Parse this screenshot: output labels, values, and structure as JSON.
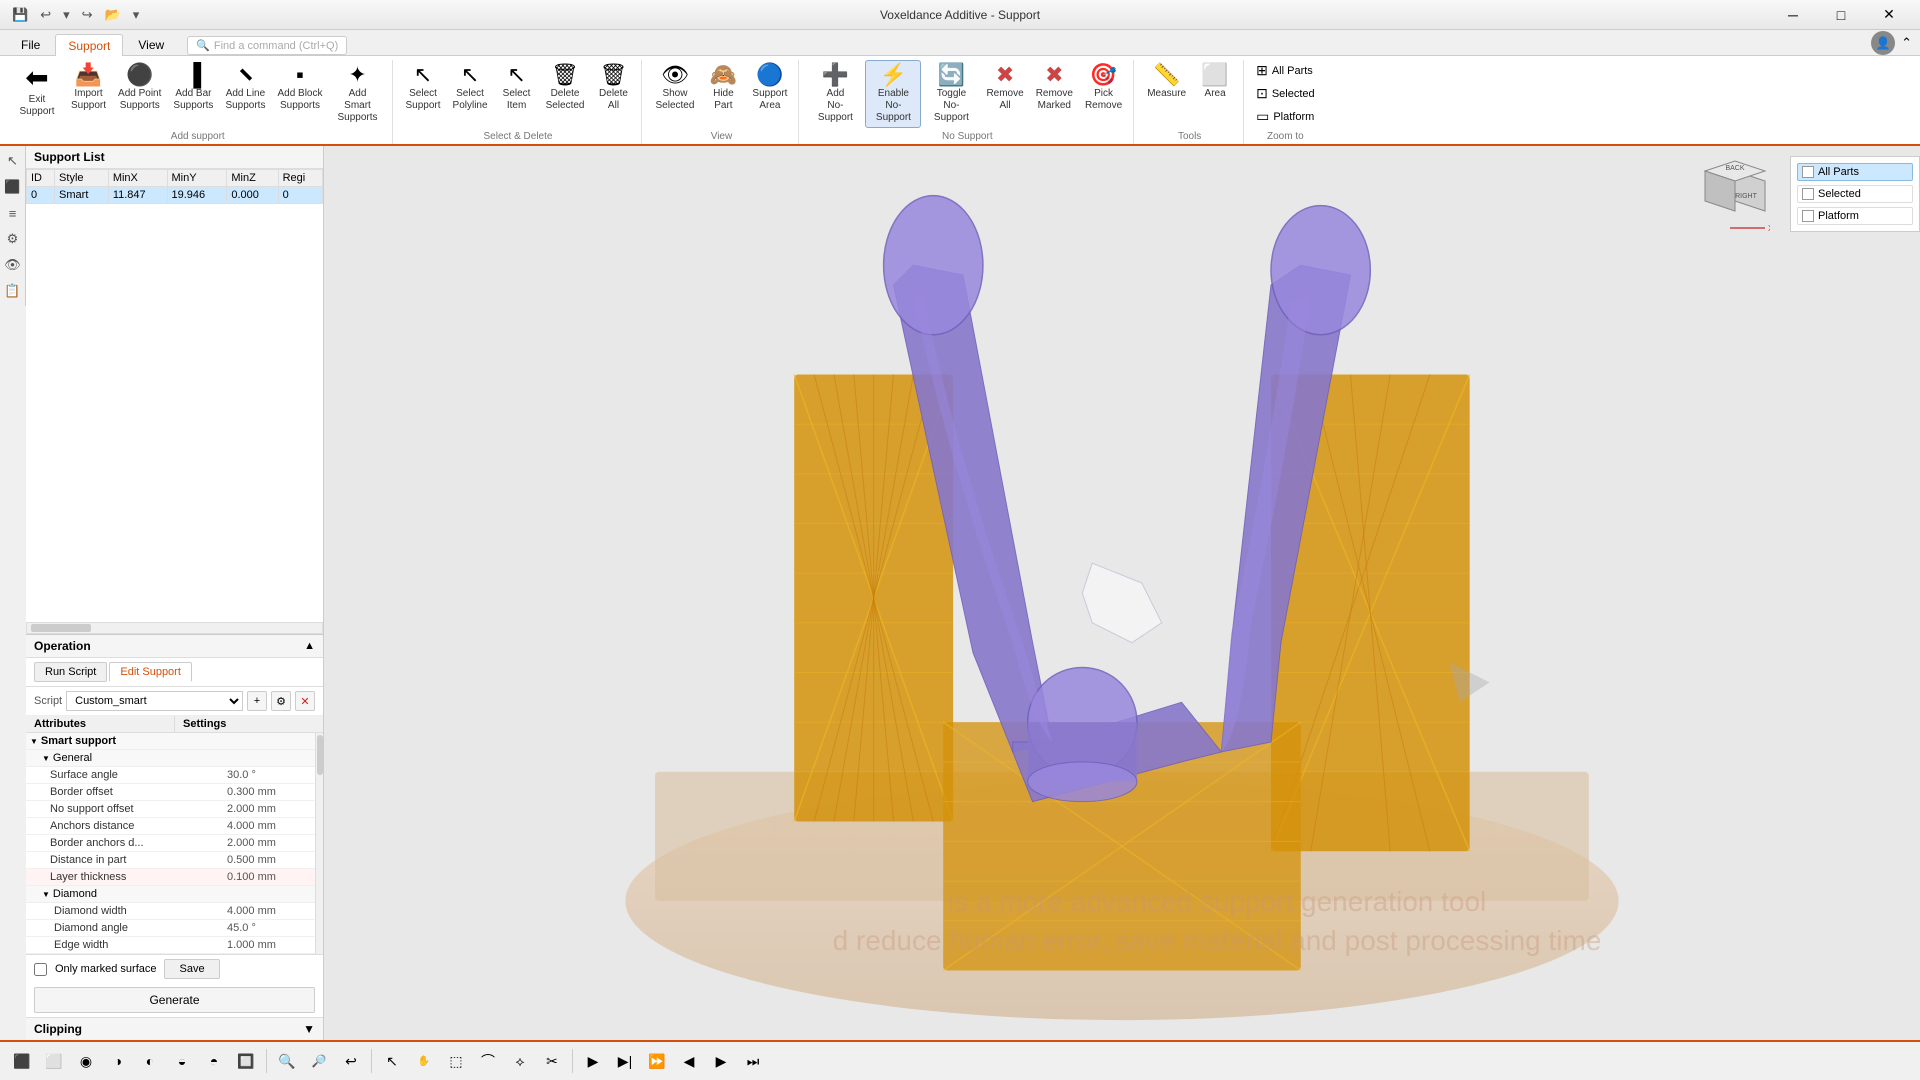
{
  "titlebar": {
    "title": "Voxeldance Additive - Support",
    "min_btn": "─",
    "max_btn": "□",
    "close_btn": "✕"
  },
  "ribbon": {
    "tabs": [
      "File",
      "Support",
      "View"
    ],
    "active_tab": "Support",
    "search_placeholder": "Find a command (Ctrl+Q)",
    "groups": [
      {
        "label": "Add support",
        "buttons": [
          {
            "id": "exit-support",
            "icon": "⬅",
            "label": "Exit\nSupport",
            "large": true
          },
          {
            "id": "import-support",
            "icon": "📥",
            "label": "Import\nSupport"
          },
          {
            "id": "add-point",
            "icon": "•",
            "label": "Add Point\nSupports"
          },
          {
            "id": "add-bar",
            "icon": "▌",
            "label": "Add Bar\nSupports"
          },
          {
            "id": "add-line",
            "icon": "╱",
            "label": "Add Line\nSupports"
          },
          {
            "id": "add-block",
            "icon": "▪",
            "label": "Add Block\nSupports"
          },
          {
            "id": "add-smart",
            "icon": "★",
            "label": "Add Smart\nSupports"
          }
        ]
      },
      {
        "label": "Select & Delete",
        "buttons": [
          {
            "id": "select-support",
            "icon": "↖",
            "label": "Select\nSupport"
          },
          {
            "id": "select-polyline",
            "icon": "↖",
            "label": "Select\nPolyline"
          },
          {
            "id": "select-item",
            "icon": "↖",
            "label": "Select\nItem"
          },
          {
            "id": "delete-selected",
            "icon": "🗑",
            "label": "Delete\nSelected"
          },
          {
            "id": "delete-all",
            "icon": "🗑",
            "label": "Delete\nAll"
          }
        ]
      },
      {
        "label": "View",
        "buttons": [
          {
            "id": "show-selected",
            "icon": "👁",
            "label": "Show\nSelected"
          },
          {
            "id": "hide-part",
            "icon": "👁",
            "label": "Hide\nPart"
          },
          {
            "id": "support-area",
            "icon": "🔵",
            "label": "Support\nArea"
          }
        ]
      },
      {
        "label": "No Support",
        "buttons": [
          {
            "id": "add-no-support",
            "icon": "➕",
            "label": "Add\nNo-Support"
          },
          {
            "id": "enable-no-support",
            "icon": "⚡",
            "label": "Enable\nNo-Support",
            "active": true
          },
          {
            "id": "toggle-no-support",
            "icon": "🔄",
            "label": "Toggle\nNo-Support"
          },
          {
            "id": "remove-all",
            "icon": "✖",
            "label": "Remove\nAll"
          },
          {
            "id": "remove-marked",
            "icon": "✖",
            "label": "Remove\nMarked"
          },
          {
            "id": "pick-remove",
            "icon": "✖",
            "label": "Pick\nRemove"
          }
        ]
      },
      {
        "label": "Tools",
        "buttons": [
          {
            "id": "measure",
            "icon": "📏",
            "label": "Measure"
          },
          {
            "id": "area",
            "icon": "⬜",
            "label": "Area"
          }
        ]
      },
      {
        "label": "Zoom to",
        "buttons": [
          {
            "id": "all-parts",
            "icon": "⊞",
            "label": "All Parts"
          },
          {
            "id": "selected",
            "icon": "⊡",
            "label": "Selected"
          },
          {
            "id": "platform",
            "icon": "▭",
            "label": "Platform"
          }
        ]
      }
    ]
  },
  "support_list": {
    "title": "Support List",
    "columns": [
      "ID",
      "Style",
      "MinX",
      "MinY",
      "MinZ",
      "Regi"
    ],
    "rows": [
      {
        "id": "0",
        "style": "Smart",
        "minx": "11.847",
        "miny": "19.946",
        "minz": "0.000",
        "regi": "0"
      }
    ]
  },
  "operation": {
    "title": "Operation",
    "tabs": [
      "Run Script",
      "Edit Support"
    ],
    "active_tab": "Edit Support",
    "script_label": "Script",
    "script_value": "Custom_smart",
    "attr_headers": [
      "Attributes",
      "Settings"
    ],
    "tree": {
      "smart_support": "Smart support",
      "general": "General",
      "attributes": [
        {
          "name": "Surface angle",
          "value": "30.0 °"
        },
        {
          "name": "Border offset",
          "value": "0.300 mm"
        },
        {
          "name": "No support offset",
          "value": "2.000 mm"
        },
        {
          "name": "Anchors distance",
          "value": "4.000 mm"
        },
        {
          "name": "Border anchors d...",
          "value": "2.000 mm"
        },
        {
          "name": "Distance in part",
          "value": "0.500 mm"
        },
        {
          "name": "Layer thickness",
          "value": "0.100 mm"
        }
      ],
      "diamond": "Diamond",
      "diamond_attrs": [
        {
          "name": "Diamond width",
          "value": "4.000 mm"
        },
        {
          "name": "Diamond angle",
          "value": "45.0 °"
        },
        {
          "name": "Edge width",
          "value": "1.000 mm"
        }
      ]
    },
    "only_marked": "Only marked surface",
    "save_btn": "Save",
    "generate_btn": "Generate",
    "clipping": "Clipping"
  },
  "viewport": {
    "bg_color": "#d8d8d8"
  },
  "right_panel": {
    "items": [
      {
        "label": "All Parts",
        "checked": false
      },
      {
        "label": "Selected",
        "checked": false
      },
      {
        "label": "Platform",
        "checked": false
      }
    ]
  },
  "watermark": {
    "line1": "is a more advanced support generation tool",
    "line2": "d reduce human error, save material and post processing time"
  },
  "bottom_toolbar": {
    "buttons": [
      "⬛",
      "⬜",
      "●",
      "◑",
      "◐",
      "◒",
      "◓",
      "🔲",
      "🔍",
      "🔍",
      "↩",
      "▶",
      "▶▶",
      "⏩",
      "◀",
      "▶",
      "⏭",
      "⏭"
    ]
  }
}
